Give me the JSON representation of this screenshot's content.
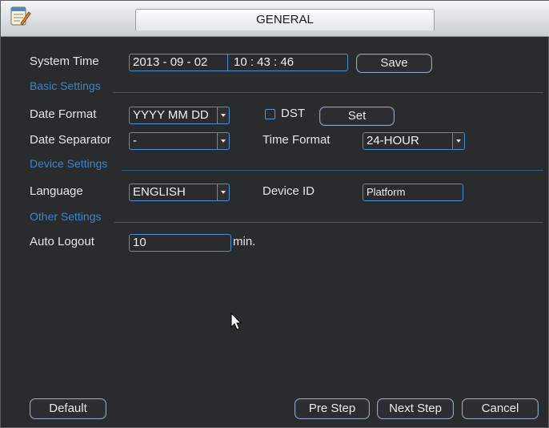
{
  "window": {
    "title": "GENERAL"
  },
  "system_time": {
    "label": "System Time",
    "date": "2013  -  09  -  02",
    "time": "10  :  43  :  46",
    "save_label": "Save"
  },
  "sections": {
    "basic": "Basic Settings",
    "device": "Device Settings",
    "other": "Other Settings"
  },
  "basic": {
    "date_format_label": "Date Format",
    "date_format_value": "YYYY MM DD",
    "dst_label": "DST",
    "dst_checked": false,
    "set_label": "Set",
    "date_separator_label": "Date Separator",
    "date_separator_value": "-",
    "time_format_label": "Time Format",
    "time_format_value": "24-HOUR"
  },
  "device": {
    "language_label": "Language",
    "language_value": "ENGLISH",
    "device_id_label": "Device ID",
    "device_id_value": "Platform"
  },
  "other": {
    "auto_logout_label": "Auto Logout",
    "auto_logout_value": "10",
    "auto_logout_unit": "min."
  },
  "footer": {
    "default_label": "Default",
    "pre_step_label": "Pre Step",
    "next_step_label": "Next Step",
    "cancel_label": "Cancel"
  },
  "icons": {
    "app": "settings-notepad-icon",
    "cursor": "mouse-pointer-icon"
  },
  "colors": {
    "accent": "#3b86c9",
    "field_border": "#4f8ed2",
    "background": "#2a2b2d"
  }
}
